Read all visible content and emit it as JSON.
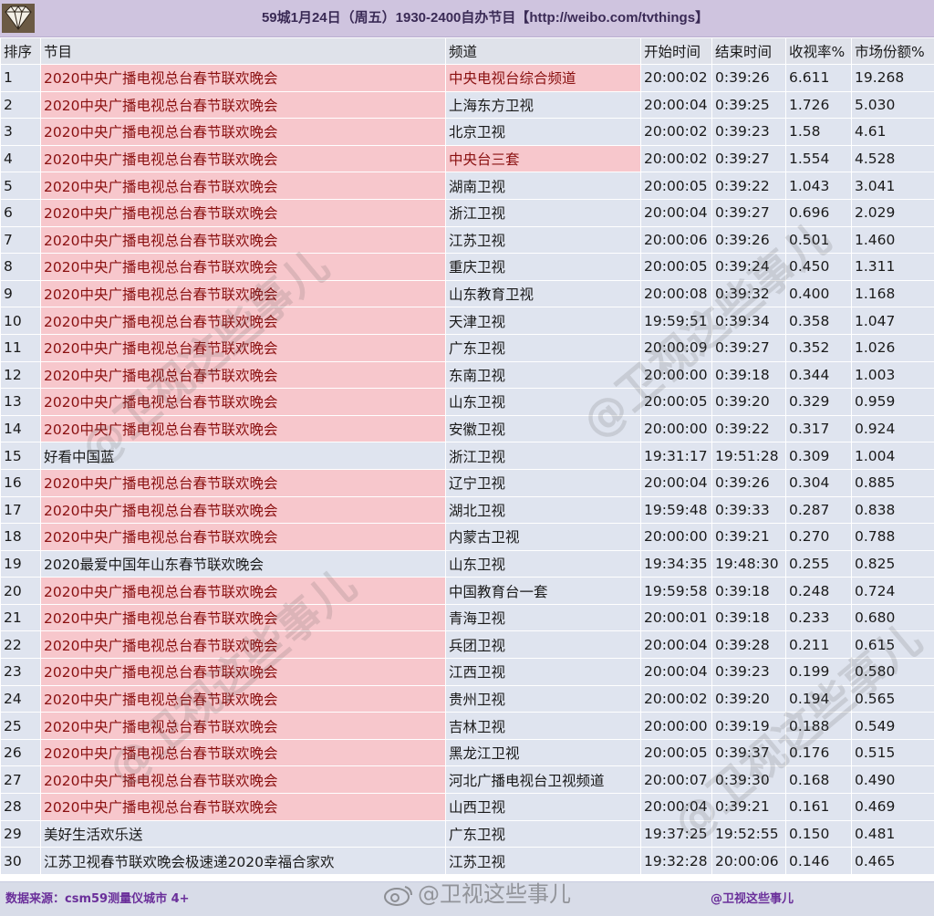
{
  "title": "59城1月24日（周五）1930-2400自办节目【http://weibo.com/tvthings】",
  "headers": [
    "排序",
    "节目",
    "频道",
    "开始时间",
    "结束时间",
    "收视率%",
    "市场份额%"
  ],
  "rows": [
    {
      "rank": "1",
      "program": "2020中央广播电视总台春节联欢晚会",
      "channel": "中央电视台综合频道",
      "start": "20:00:02",
      "end": "0:39:26",
      "rating": "6.611",
      "share": "19.268",
      "program_pink": true,
      "channel_pink": true
    },
    {
      "rank": "2",
      "program": "2020中央广播电视总台春节联欢晚会",
      "channel": "上海东方卫视",
      "start": "20:00:04",
      "end": "0:39:25",
      "rating": "1.726",
      "share": "5.030",
      "program_pink": true,
      "channel_pink": false
    },
    {
      "rank": "3",
      "program": "2020中央广播电视总台春节联欢晚会",
      "channel": "北京卫视",
      "start": "20:00:02",
      "end": "0:39:23",
      "rating": "1.58",
      "share": "4.61",
      "program_pink": true,
      "channel_pink": false
    },
    {
      "rank": "4",
      "program": "2020中央广播电视总台春节联欢晚会",
      "channel": "中央台三套",
      "start": "20:00:02",
      "end": "0:39:27",
      "rating": "1.554",
      "share": "4.528",
      "program_pink": true,
      "channel_pink": true
    },
    {
      "rank": "5",
      "program": "2020中央广播电视总台春节联欢晚会",
      "channel": "湖南卫视",
      "start": "20:00:05",
      "end": "0:39:22",
      "rating": "1.043",
      "share": "3.041",
      "program_pink": true,
      "channel_pink": false
    },
    {
      "rank": "6",
      "program": "2020中央广播电视总台春节联欢晚会",
      "channel": "浙江卫视",
      "start": "20:00:04",
      "end": "0:39:27",
      "rating": "0.696",
      "share": "2.029",
      "program_pink": true,
      "channel_pink": false
    },
    {
      "rank": "7",
      "program": "2020中央广播电视总台春节联欢晚会",
      "channel": "江苏卫视",
      "start": "20:00:06",
      "end": "0:39:26",
      "rating": "0.501",
      "share": "1.460",
      "program_pink": true,
      "channel_pink": false
    },
    {
      "rank": "8",
      "program": "2020中央广播电视总台春节联欢晚会",
      "channel": "重庆卫视",
      "start": "20:00:05",
      "end": "0:39:24",
      "rating": "0.450",
      "share": "1.311",
      "program_pink": true,
      "channel_pink": false
    },
    {
      "rank": "9",
      "program": "2020中央广播电视总台春节联欢晚会",
      "channel": "山东教育卫视",
      "start": "20:00:08",
      "end": "0:39:32",
      "rating": "0.400",
      "share": "1.168",
      "program_pink": true,
      "channel_pink": false
    },
    {
      "rank": "10",
      "program": "2020中央广播电视总台春节联欢晚会",
      "channel": "天津卫视",
      "start": "19:59:51",
      "end": "0:39:34",
      "rating": "0.358",
      "share": "1.047",
      "program_pink": true,
      "channel_pink": false
    },
    {
      "rank": "11",
      "program": "2020中央广播电视总台春节联欢晚会",
      "channel": "广东卫视",
      "start": "20:00:09",
      "end": "0:39:27",
      "rating": "0.352",
      "share": "1.026",
      "program_pink": true,
      "channel_pink": false
    },
    {
      "rank": "12",
      "program": "2020中央广播电视总台春节联欢晚会",
      "channel": "东南卫视",
      "start": "20:00:00",
      "end": "0:39:18",
      "rating": "0.344",
      "share": "1.003",
      "program_pink": true,
      "channel_pink": false
    },
    {
      "rank": "13",
      "program": "2020中央广播电视总台春节联欢晚会",
      "channel": "山东卫视",
      "start": "20:00:05",
      "end": "0:39:20",
      "rating": "0.329",
      "share": "0.959",
      "program_pink": true,
      "channel_pink": false
    },
    {
      "rank": "14",
      "program": "2020中央广播电视总台春节联欢晚会",
      "channel": "安徽卫视",
      "start": "20:00:00",
      "end": "0:39:22",
      "rating": "0.317",
      "share": "0.924",
      "program_pink": true,
      "channel_pink": false
    },
    {
      "rank": "15",
      "program": "好看中国蓝",
      "channel": "浙江卫视",
      "start": "19:31:17",
      "end": "19:51:28",
      "rating": "0.309",
      "share": "1.004",
      "program_pink": false,
      "channel_pink": false
    },
    {
      "rank": "16",
      "program": "2020中央广播电视总台春节联欢晚会",
      "channel": "辽宁卫视",
      "start": "20:00:04",
      "end": "0:39:26",
      "rating": "0.304",
      "share": "0.885",
      "program_pink": true,
      "channel_pink": false
    },
    {
      "rank": "17",
      "program": "2020中央广播电视总台春节联欢晚会",
      "channel": "湖北卫视",
      "start": "19:59:48",
      "end": "0:39:33",
      "rating": "0.287",
      "share": "0.838",
      "program_pink": true,
      "channel_pink": false
    },
    {
      "rank": "18",
      "program": "2020中央广播电视总台春节联欢晚会",
      "channel": "内蒙古卫视",
      "start": "20:00:00",
      "end": "0:39:21",
      "rating": "0.270",
      "share": "0.788",
      "program_pink": true,
      "channel_pink": false
    },
    {
      "rank": "19",
      "program": "2020最爱中国年山东春节联欢晚会",
      "channel": "山东卫视",
      "start": "19:34:35",
      "end": "19:48:30",
      "rating": "0.255",
      "share": "0.825",
      "program_pink": false,
      "channel_pink": false
    },
    {
      "rank": "20",
      "program": "2020中央广播电视总台春节联欢晚会",
      "channel": "中国教育台一套",
      "start": "19:59:58",
      "end": "0:39:18",
      "rating": "0.248",
      "share": "0.724",
      "program_pink": true,
      "channel_pink": false
    },
    {
      "rank": "21",
      "program": "2020中央广播电视总台春节联欢晚会",
      "channel": "青海卫视",
      "start": "20:00:01",
      "end": "0:39:18",
      "rating": "0.233",
      "share": "0.680",
      "program_pink": true,
      "channel_pink": false
    },
    {
      "rank": "22",
      "program": "2020中央广播电视总台春节联欢晚会",
      "channel": "兵团卫视",
      "start": "20:00:04",
      "end": "0:39:28",
      "rating": "0.211",
      "share": "0.615",
      "program_pink": true,
      "channel_pink": false
    },
    {
      "rank": "23",
      "program": "2020中央广播电视总台春节联欢晚会",
      "channel": "江西卫视",
      "start": "20:00:04",
      "end": "0:39:23",
      "rating": "0.199",
      "share": "0.580",
      "program_pink": true,
      "channel_pink": false
    },
    {
      "rank": "24",
      "program": "2020中央广播电视总台春节联欢晚会",
      "channel": "贵州卫视",
      "start": "20:00:02",
      "end": "0:39:20",
      "rating": "0.194",
      "share": "0.565",
      "program_pink": true,
      "channel_pink": false
    },
    {
      "rank": "25",
      "program": "2020中央广播电视总台春节联欢晚会",
      "channel": "吉林卫视",
      "start": "20:00:00",
      "end": "0:39:19",
      "rating": "0.188",
      "share": "0.549",
      "program_pink": true,
      "channel_pink": false
    },
    {
      "rank": "26",
      "program": "2020中央广播电视总台春节联欢晚会",
      "channel": "黑龙江卫视",
      "start": "20:00:05",
      "end": "0:39:37",
      "rating": "0.176",
      "share": "0.515",
      "program_pink": true,
      "channel_pink": false
    },
    {
      "rank": "27",
      "program": "2020中央广播电视总台春节联欢晚会",
      "channel": "河北广播电视台卫视频道",
      "start": "20:00:07",
      "end": "0:39:30",
      "rating": "0.168",
      "share": "0.490",
      "program_pink": true,
      "channel_pink": false
    },
    {
      "rank": "28",
      "program": "2020中央广播电视总台春节联欢晚会",
      "channel": "山西卫视",
      "start": "20:00:04",
      "end": "0:39:21",
      "rating": "0.161",
      "share": "0.469",
      "program_pink": true,
      "channel_pink": false
    },
    {
      "rank": "29",
      "program": "美好生活欢乐送",
      "channel": "广东卫视",
      "start": "19:37:25",
      "end": "19:52:55",
      "rating": "0.150",
      "share": "0.481",
      "program_pink": false,
      "channel_pink": false
    },
    {
      "rank": "30",
      "program": "江苏卫视春节联欢晚会极速递2020幸福合家欢",
      "channel": "江苏卫视",
      "start": "19:32:28",
      "end": "20:00:06",
      "rating": "0.146",
      "share": "0.465",
      "program_pink": false,
      "channel_pink": false
    }
  ],
  "footer": {
    "source": "数据来源：csm59测量仪城市 4+",
    "brand": "@卫视这些事儿",
    "watermark_text": "@卫视这些事儿"
  },
  "colors": {
    "title_bar": "#cfc4df",
    "row_bg": "#dfe4ef",
    "pink_cell": "#f7c7cc",
    "pink_text": "#8a1010",
    "footer_text": "#6a2f9a"
  },
  "icons": {
    "logo": "diamond-logo-icon",
    "watermark": "weibo-eye-icon"
  }
}
